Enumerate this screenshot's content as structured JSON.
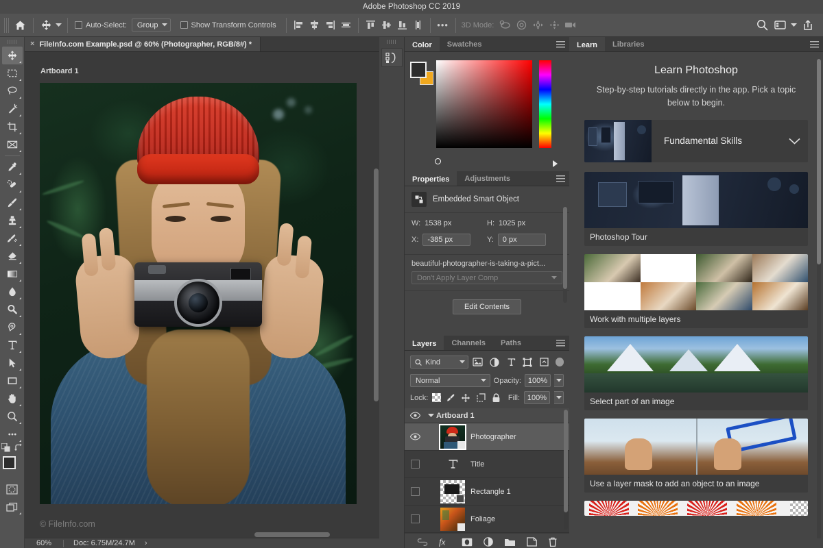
{
  "app": {
    "title": "Adobe Photoshop CC 2019"
  },
  "options_bar": {
    "home_icon": "home-icon",
    "active_tool_icon": "move-tool-icon",
    "auto_select_label": "Auto-Select:",
    "auto_select_value": "Group",
    "show_transform_label": "Show Transform Controls",
    "more_label": "•••",
    "mode_3d_label": "3D Mode:",
    "align_icons": [
      "align-left-edges-icon",
      "align-horizontal-centers-icon",
      "align-right-edges-icon",
      "distribute-horizontally-icon",
      "align-top-edges-icon",
      "align-vertical-centers-icon",
      "align-bottom-edges-icon",
      "distribute-vertically-icon"
    ],
    "mode_3d_icons": [
      "orbit-3d-icon",
      "roll-3d-icon",
      "pan-3d-icon",
      "slide-3d-icon",
      "camera-3d-icon"
    ],
    "right_icons": [
      "search-icon",
      "workspace-icon",
      "chevron-down-icon",
      "share-icon"
    ]
  },
  "toolbar": {
    "tools": [
      {
        "name": "move-tool",
        "active": true
      },
      {
        "name": "rectangular-marquee-tool",
        "active": false
      },
      {
        "name": "lasso-tool",
        "active": false
      },
      {
        "name": "magic-wand-tool",
        "active": false
      },
      {
        "name": "crop-tool",
        "active": false
      },
      {
        "name": "frame-tool",
        "active": false
      },
      {
        "name": "eyedropper-tool",
        "active": false
      },
      {
        "name": "healing-brush-tool",
        "active": false
      },
      {
        "name": "brush-tool",
        "active": false
      },
      {
        "name": "clone-stamp-tool",
        "active": false
      },
      {
        "name": "history-brush-tool",
        "active": false
      },
      {
        "name": "eraser-tool",
        "active": false
      },
      {
        "name": "gradient-tool",
        "active": false
      },
      {
        "name": "blur-tool",
        "active": false
      },
      {
        "name": "dodge-tool",
        "active": false
      },
      {
        "name": "pen-tool",
        "active": false
      },
      {
        "name": "type-tool",
        "active": false
      },
      {
        "name": "path-selection-tool",
        "active": false
      },
      {
        "name": "rectangle-tool",
        "active": false
      },
      {
        "name": "hand-tool",
        "active": false
      },
      {
        "name": "zoom-tool",
        "active": false
      },
      {
        "name": "edit-toolbar-tool",
        "active": false
      }
    ],
    "foreground_color": "#2d2d2d",
    "background_color": "#f0a81e"
  },
  "document": {
    "tab_title": "FileInfo.com Example.psd @ 60% (Photographer, RGB/8#) *",
    "close_label": "×",
    "artboard_label": "Artboard 1",
    "watermark": "© FileInfo.com"
  },
  "status_bar": {
    "zoom": "60%",
    "doc_info": "Doc: 6.75M/24.7M",
    "arrow": "›"
  },
  "color_panel": {
    "tabs": [
      {
        "label": "Color",
        "active": true
      },
      {
        "label": "Swatches",
        "active": false
      }
    ],
    "foreground": "#2d2d2d",
    "background": "#f0a81e",
    "hue": "#ff0000"
  },
  "properties_panel": {
    "tabs": [
      {
        "label": "Properties",
        "active": true
      },
      {
        "label": "Adjustments",
        "active": false
      }
    ],
    "object_type": "Embedded Smart Object",
    "object_icon": "smart-object-icon",
    "w_label": "W:",
    "w_value": "1538 px",
    "h_label": "H:",
    "h_value": "1025 px",
    "x_label": "X:",
    "x_value": "-385 px",
    "y_label": "Y:",
    "y_value": "0 px",
    "filename": "beautiful-photographer-is-taking-a-pict...",
    "layer_comp": "Don't Apply Layer Comp",
    "edit_button": "Edit Contents"
  },
  "layers_panel": {
    "tabs": [
      {
        "label": "Layers",
        "active": true
      },
      {
        "label": "Channels",
        "active": false
      },
      {
        "label": "Paths",
        "active": false
      }
    ],
    "filter_kind": "Kind",
    "filter_icons": [
      "filter-image-icon",
      "filter-adjustment-icon",
      "filter-type-icon",
      "filter-shape-icon",
      "filter-smartobject-icon"
    ],
    "blend_mode": "Normal",
    "opacity_label": "Opacity:",
    "opacity_value": "100%",
    "lock_label": "Lock:",
    "lock_icons": [
      "lock-transparent-pixels-icon",
      "lock-image-pixels-icon",
      "lock-position-icon",
      "lock-artboard-nesting-icon",
      "lock-all-icon"
    ],
    "fill_label": "Fill:",
    "fill_value": "100%",
    "layers": [
      {
        "name": "Artboard 1",
        "type": "group",
        "visible": true,
        "selected": false,
        "thumb": "none"
      },
      {
        "name": "Photographer",
        "type": "smart-object",
        "visible": true,
        "selected": true,
        "thumb": "photo"
      },
      {
        "name": "Title",
        "type": "text",
        "visible": false,
        "selected": false,
        "thumb": "type"
      },
      {
        "name": "Rectangle 1",
        "type": "shape",
        "visible": false,
        "selected": false,
        "thumb": "shape"
      },
      {
        "name": "Foliage",
        "type": "smart-object",
        "visible": false,
        "selected": false,
        "thumb": "foliage"
      }
    ],
    "bottom_icons": [
      "link-layers-icon",
      "layer-style-fx-icon",
      "add-layer-mask-icon",
      "adjustment-layer-icon",
      "new-group-icon",
      "new-layer-icon",
      "delete-layer-icon"
    ]
  },
  "learn_panel": {
    "tabs": [
      {
        "label": "Learn",
        "active": true
      },
      {
        "label": "Libraries",
        "active": false
      }
    ],
    "heading": "Learn Photoshop",
    "subheading": "Step-by-step tutorials directly in the app. Pick a topic below to begin.",
    "section": {
      "label": "Fundamental Skills",
      "chevron": "chevron-down-icon"
    },
    "cards": [
      {
        "title": "Photoshop Tour",
        "art": "room"
      },
      {
        "title": "Work with multiple layers",
        "art": "layers"
      },
      {
        "title": "Select part of an image",
        "art": "mountains"
      },
      {
        "title": "Use a layer mask to add an object to an image",
        "art": "hands"
      },
      {
        "title": "",
        "art": "fan"
      }
    ]
  },
  "icon_dock": {
    "buttons": [
      "history-panel-icon"
    ]
  }
}
